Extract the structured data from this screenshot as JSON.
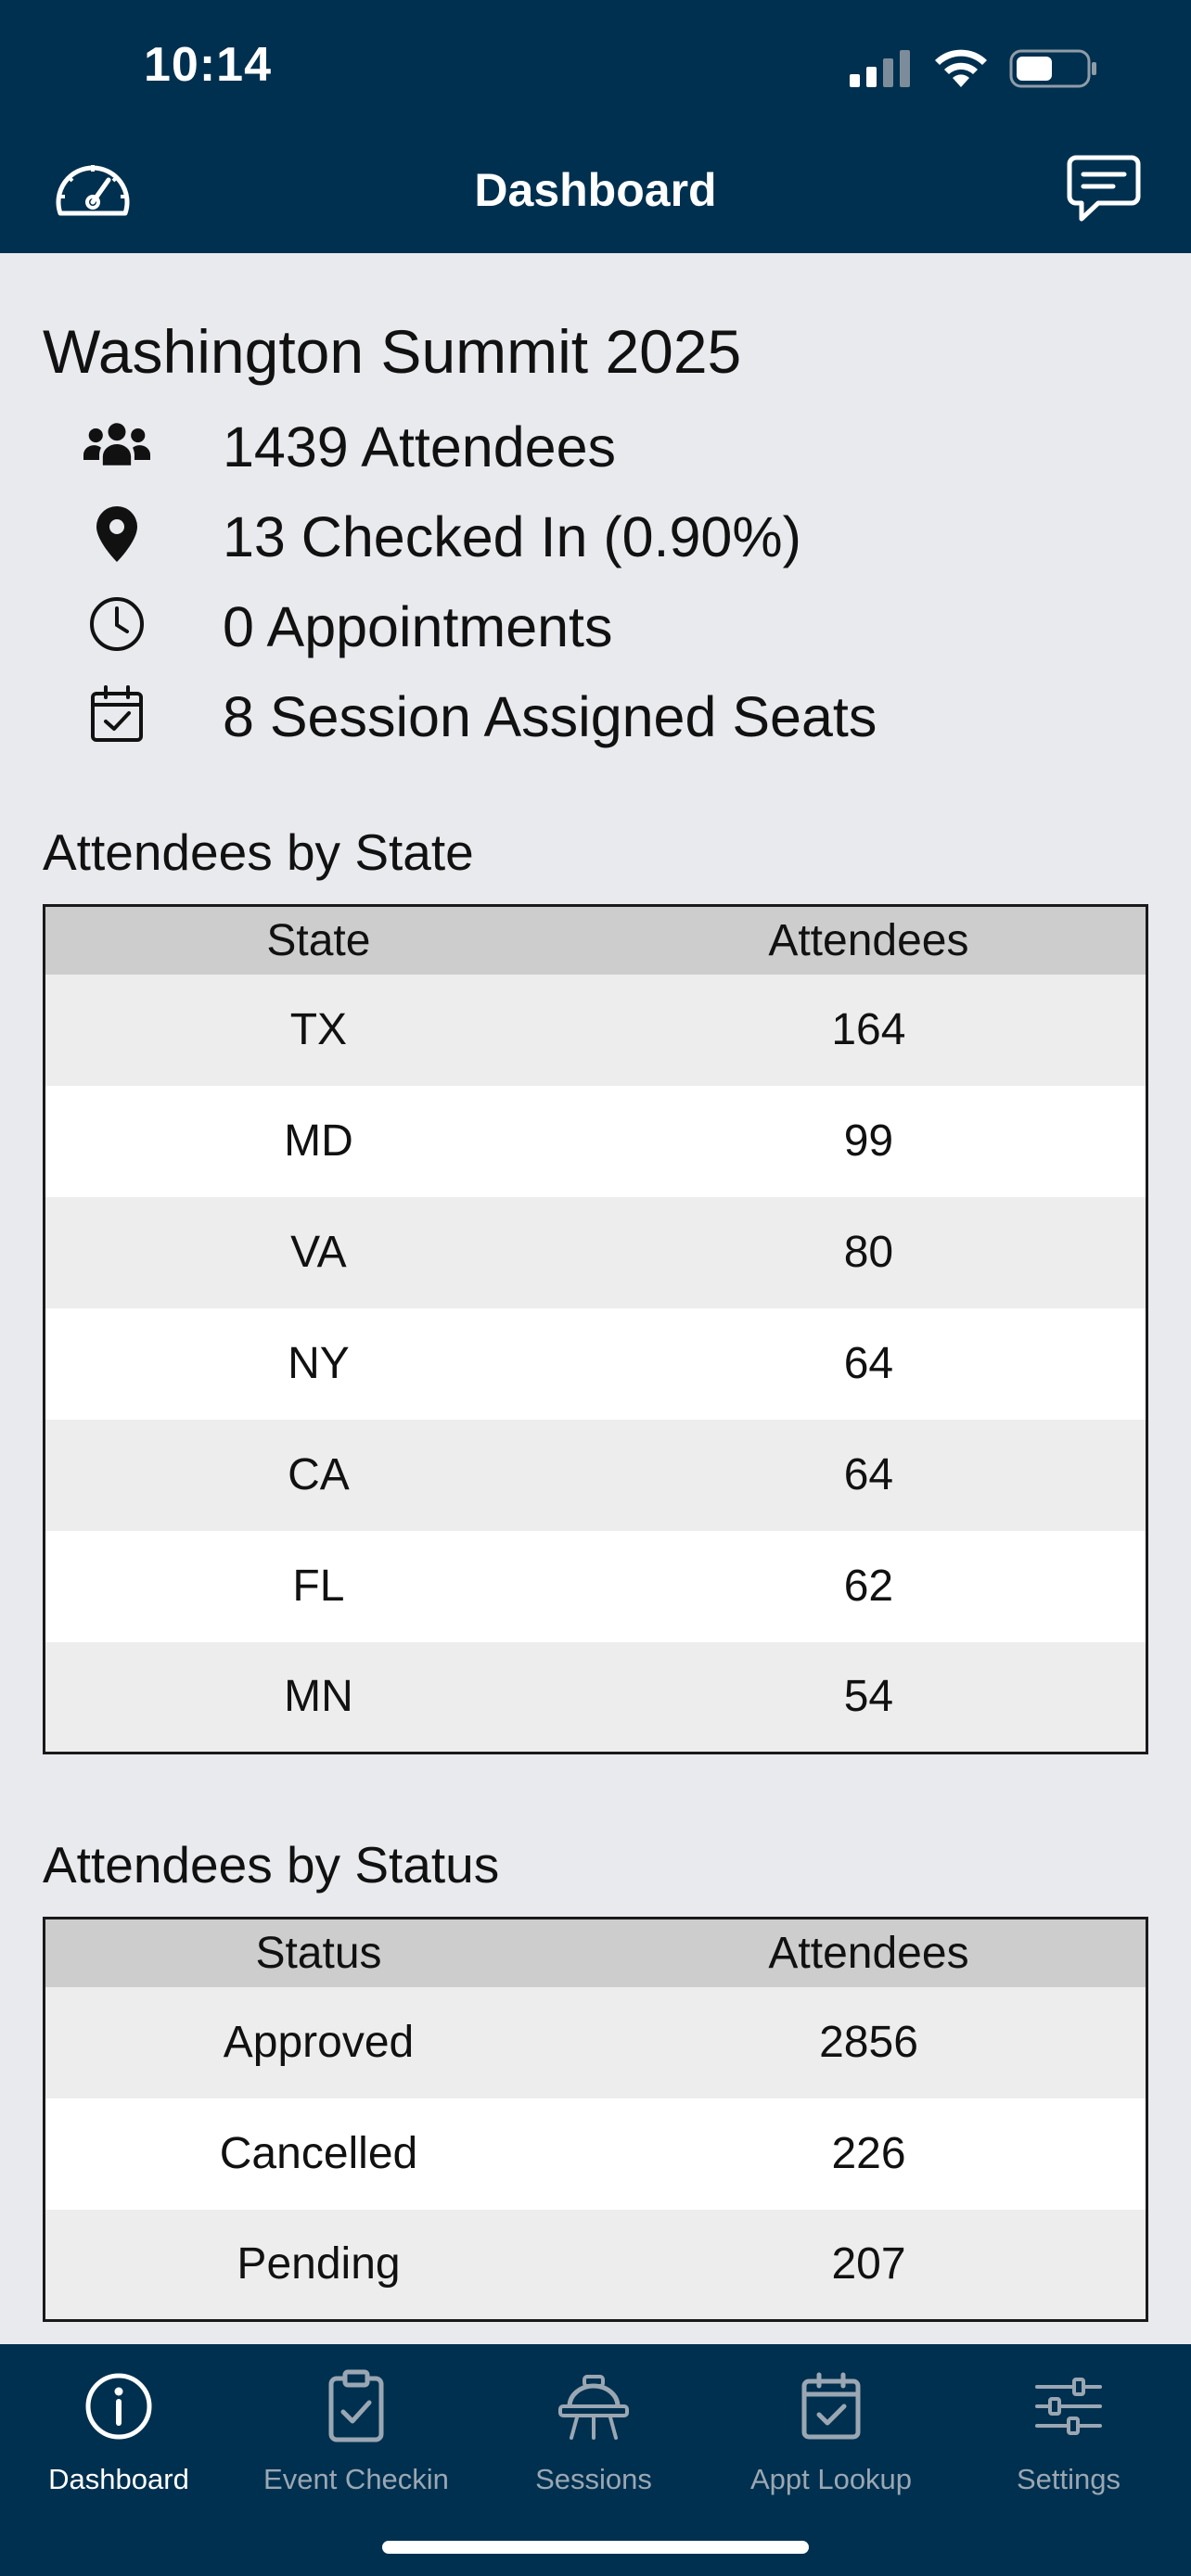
{
  "status_bar": {
    "time": "10:14"
  },
  "nav": {
    "title": "Dashboard",
    "left_icon": "dashboard-gauge-icon",
    "right_icon": "chat-icon"
  },
  "event": {
    "title": "Washington Summit 2025",
    "stats": [
      {
        "icon": "people-icon",
        "text": "1439 Attendees"
      },
      {
        "icon": "location-pin-icon",
        "text": "13 Checked In (0.90%)"
      },
      {
        "icon": "clock-icon",
        "text": "0 Appointments"
      },
      {
        "icon": "calendar-check-icon",
        "text": "8 Session Assigned Seats"
      }
    ]
  },
  "by_state": {
    "title": "Attendees by State",
    "headers": [
      "State",
      "Attendees"
    ],
    "rows": [
      [
        "TX",
        "164"
      ],
      [
        "MD",
        "99"
      ],
      [
        "VA",
        "80"
      ],
      [
        "NY",
        "64"
      ],
      [
        "CA",
        "64"
      ],
      [
        "FL",
        "62"
      ],
      [
        "MN",
        "54"
      ]
    ]
  },
  "by_status": {
    "title": "Attendees by Status",
    "headers": [
      "Status",
      "Attendees"
    ],
    "rows": [
      [
        "Approved",
        "2856"
      ],
      [
        "Cancelled",
        "226"
      ],
      [
        "Pending",
        "207"
      ]
    ]
  },
  "tabs": [
    {
      "label": "Dashboard",
      "icon": "info-icon",
      "active": true
    },
    {
      "label": "Event Checkin",
      "icon": "clipboard-check-icon",
      "active": false
    },
    {
      "label": "Sessions",
      "icon": "presentation-icon",
      "active": false
    },
    {
      "label": "Appt Lookup",
      "icon": "calendar-check-icon",
      "active": false
    },
    {
      "label": "Settings",
      "icon": "sliders-icon",
      "active": false
    }
  ],
  "colors": {
    "header": "#00304f",
    "background": "#e9eaee",
    "tab_inactive": "#9aa7b3"
  }
}
